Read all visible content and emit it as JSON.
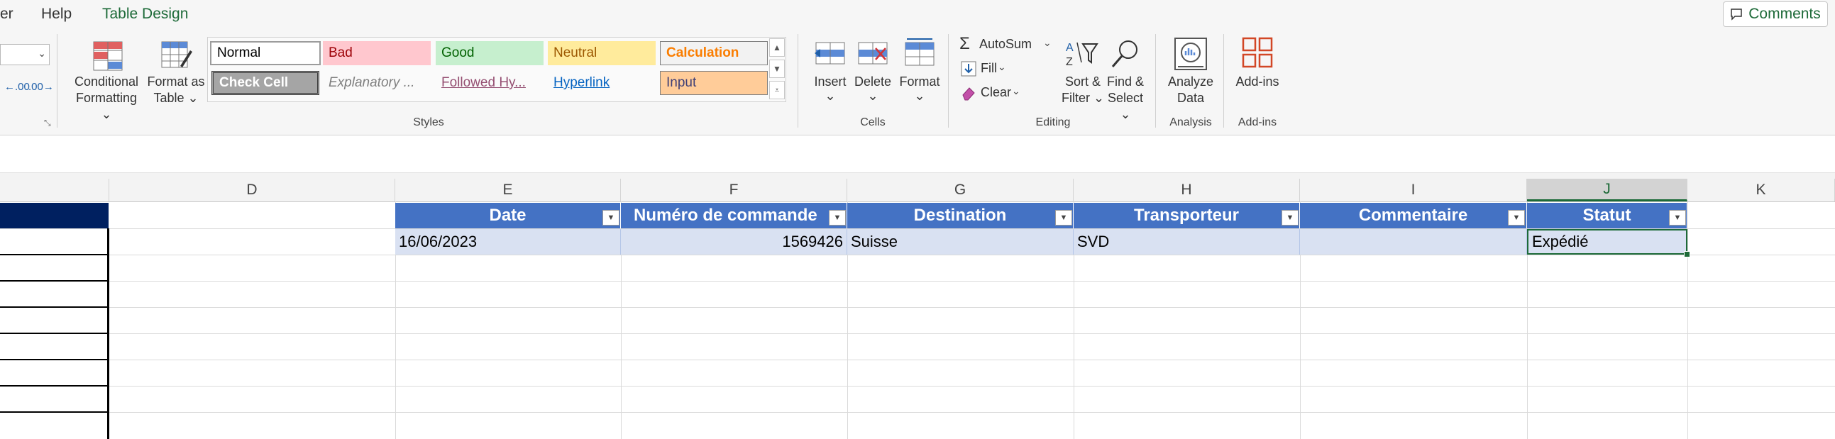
{
  "tabs": {
    "partial_left": "er",
    "help": "Help",
    "table_design": "Table Design"
  },
  "comments_label": "Comments",
  "number_group": {
    "dec_increase": ".00",
    "dec_decrease": ".00"
  },
  "styles_group": {
    "conditional_formatting": [
      "Conditional",
      "Formatting"
    ],
    "format_as_table": [
      "Format as",
      "Table"
    ],
    "cells": {
      "normal": "Normal",
      "bad": "Bad",
      "good": "Good",
      "neutral": "Neutral",
      "calculation": "Calculation",
      "check_cell": "Check Cell",
      "explanatory": "Explanatory ...",
      "followed": "Followed Hy...",
      "hyperlink": "Hyperlink",
      "input": "Input"
    },
    "label": "Styles"
  },
  "cells_group": {
    "insert": "Insert",
    "delete": "Delete",
    "format": "Format",
    "label": "Cells"
  },
  "editing_group": {
    "autosum": "AutoSum",
    "fill": "Fill",
    "clear": "Clear",
    "sort_filter": [
      "Sort &",
      "Filter"
    ],
    "find_select": [
      "Find &",
      "Select"
    ],
    "label": "Editing"
  },
  "analysis_group": {
    "analyze_data": [
      "Analyze",
      "Data"
    ],
    "label": "Analysis"
  },
  "addins_group": {
    "addins": "Add-ins",
    "label": "Add-ins"
  },
  "columns": [
    "D",
    "E",
    "F",
    "G",
    "H",
    "I",
    "J",
    "K"
  ],
  "table": {
    "headers": [
      "Date",
      "Numéro de commande",
      "Destination",
      "Transporteur",
      "Commentaire",
      "Statut"
    ],
    "row": [
      "16/06/2023",
      "1569426",
      "Suisse",
      "SVD",
      "",
      "Expédié"
    ]
  },
  "colors": {
    "accent": "#1d6a38",
    "table_header": "#4472c4",
    "table_row": "#d9e1f2"
  }
}
